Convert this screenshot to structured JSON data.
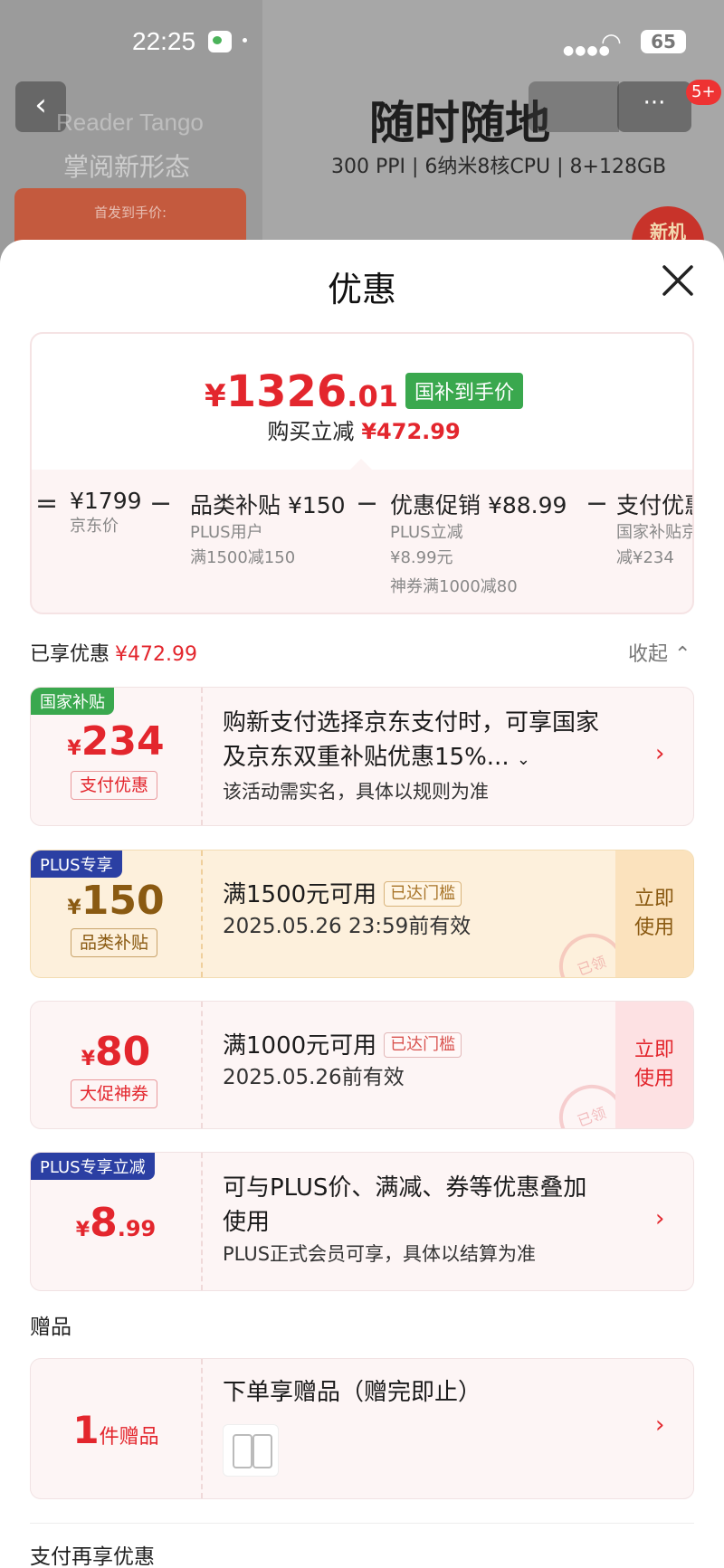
{
  "status_bar": {
    "time": "22:25",
    "battery": "65"
  },
  "background_page": {
    "brand": "Reader Tango",
    "slogan": "掌阅新形态",
    "price_label": "首发到手价:",
    "headline": "随时随地",
    "specs": "300 PPI  | 6纳米8核CPU | 8+128GB",
    "notification_count": "5+",
    "new_tag": "新机",
    "more_label": "···"
  },
  "sheet": {
    "title": "优惠",
    "summary": {
      "yen": "¥",
      "price_int": "1326",
      "price_dec": ".01",
      "price_tag": "国补到手价",
      "reduce_label": "购买立减",
      "reduce_value": "¥472.99",
      "calc": [
        {
          "op": "=",
          "head": "¥1799",
          "subs": [
            "京东价"
          ]
        },
        {
          "op": "−",
          "head": "品类补贴 ¥150",
          "subs": [
            "PLUS用户",
            "满1500减150"
          ]
        },
        {
          "op": "−",
          "head": "优惠促销 ¥88.99",
          "subs": [
            "PLUS立减",
            "¥8.99元",
            "神券满1000减80"
          ]
        },
        {
          "op": "−",
          "head": "支付优惠",
          "subs": [
            "国家补贴京",
            "减¥234"
          ]
        }
      ]
    },
    "enjoyed_label": "已享优惠",
    "enjoyed_value": "¥472.99",
    "collapse_label": "收起",
    "coupons": [
      {
        "corner": "国家补贴",
        "yen": "¥",
        "amount": "234",
        "decimal": "",
        "pill": "支付优惠",
        "line1": "购新支付选择京东支付时，可享国家",
        "line2": "及京东双重补贴优惠15%...",
        "line3": "该活动需实名，具体以规则为准"
      },
      {
        "corner": "PLUS专享",
        "yen": "¥",
        "amount": "150",
        "decimal": "",
        "pill": "品类补贴",
        "line1": "满1500元可用",
        "threshold": "已达门槛",
        "line2": "2025.05.26 23:59前有效",
        "use1": "立即",
        "use2": "使用",
        "stamp": "已领"
      },
      {
        "corner": "",
        "yen": "¥",
        "amount": "80",
        "decimal": "",
        "pill": "大促神券",
        "line1": "满1000元可用",
        "threshold": "已达门槛",
        "line2": "2025.05.26前有效",
        "use1": "立即",
        "use2": "使用",
        "stamp": "已领"
      },
      {
        "corner": "PLUS专享立减",
        "yen": "¥",
        "amount": "8",
        "decimal": ".99",
        "line1": "可与PLUS价、满减、券等优惠叠加",
        "line2": "使用",
        "line3": "PLUS正式会员可享，具体以结算为准"
      }
    ],
    "gift_section": "赠品",
    "gift": {
      "count": "1",
      "unit": "件赠品",
      "title": "下单享赠品（赠完即止）"
    },
    "pay_section": "支付再享优惠"
  },
  "colors": {
    "accent_red": "#e3262d",
    "green_tag": "#3aa84e",
    "plus_blue": "#2b3fa3",
    "gold": "#8a5a12"
  }
}
